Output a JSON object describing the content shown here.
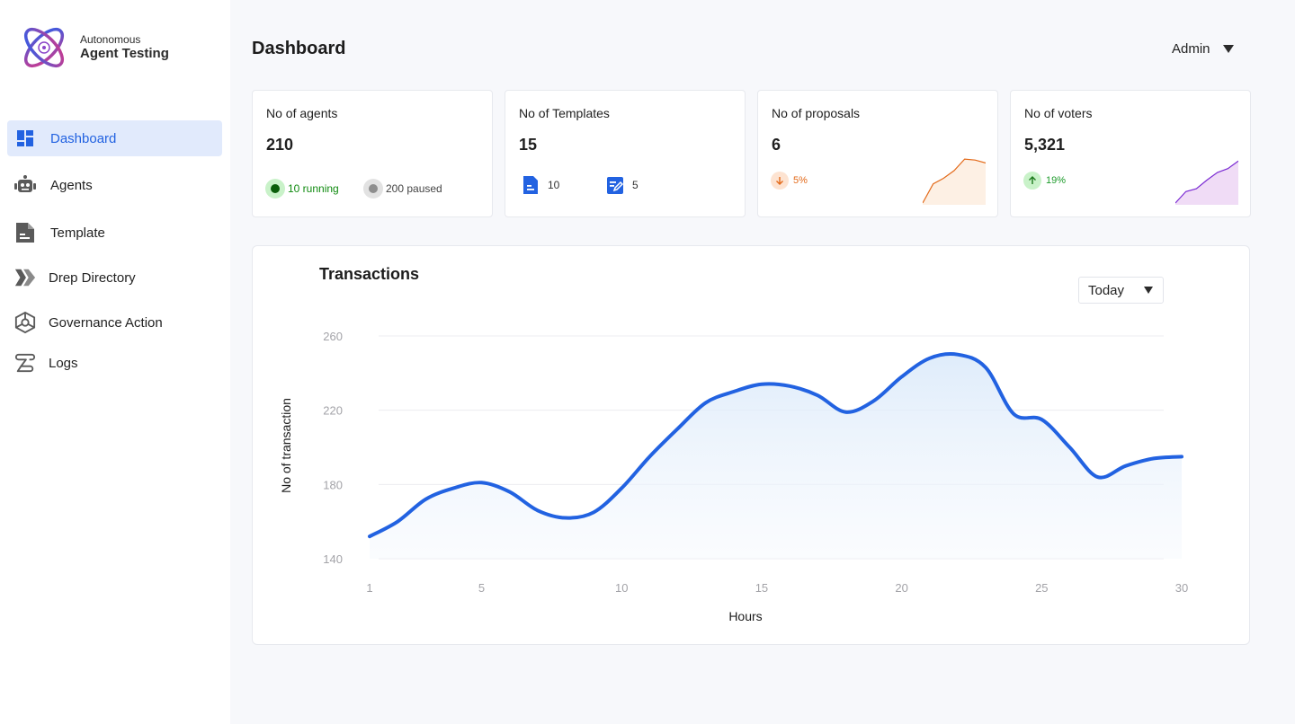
{
  "brand": {
    "line1": "Autonomous",
    "line2": "Agent Testing"
  },
  "sidebar": {
    "items": [
      {
        "label": "Dashboard",
        "icon": "dashboard-icon",
        "active": true
      },
      {
        "label": "Agents",
        "icon": "robot-icon"
      },
      {
        "label": "Template",
        "icon": "document-icon"
      },
      {
        "label": "Drep Directory",
        "icon": "chevrons-icon"
      },
      {
        "label": "Governance Action",
        "icon": "hexagon-network-icon"
      },
      {
        "label": "Logs",
        "icon": "scroll-icon"
      }
    ]
  },
  "header": {
    "title": "Dashboard",
    "user": "Admin"
  },
  "stats": {
    "agents": {
      "title": "No of agents",
      "value": "210",
      "running": "10 running",
      "paused": "200 paused"
    },
    "templates": {
      "title": "No of Templates",
      "value": "15",
      "docs": "10",
      "edited": "5"
    },
    "proposals": {
      "title": "No of proposals",
      "value": "6",
      "trend": "5%",
      "direction": "down"
    },
    "voters": {
      "title": "No of voters",
      "value": "5,321",
      "trend": "19%",
      "direction": "up"
    }
  },
  "colors": {
    "accent": "#2262e1",
    "active_bg": "#e1eafc",
    "running": "#0f8a0f",
    "paused": "#8e8e8e",
    "down": "#e36a1a",
    "up": "#1c9a2a",
    "voters_line": "#7b2bd3"
  },
  "chart": {
    "title": "Transactions",
    "period": "Today"
  },
  "chart_data": {
    "type": "area",
    "title": "Transactions",
    "xlabel": "Hours",
    "ylabel": "No of transaction",
    "x_ticks": [
      1,
      5,
      10,
      15,
      20,
      25,
      30
    ],
    "y_ticks": [
      140,
      180,
      220,
      260
    ],
    "ylim": [
      140,
      260
    ],
    "xlim": [
      1,
      30
    ],
    "grid": true,
    "series": [
      {
        "x": [
          1,
          2,
          3,
          4,
          5,
          6,
          7,
          8,
          9,
          10,
          11,
          12,
          13,
          14,
          15,
          16,
          17,
          18,
          19,
          20,
          21,
          22,
          23,
          24,
          25,
          26,
          27,
          28,
          29,
          30
        ],
        "values": [
          152,
          160,
          172,
          178,
          181,
          176,
          166,
          162,
          165,
          178,
          195,
          210,
          224,
          230,
          234,
          233,
          228,
          219,
          225,
          238,
          248,
          250,
          243,
          218,
          215,
          200,
          184,
          190,
          194,
          195
        ]
      }
    ]
  },
  "sparklines": {
    "proposals": [
      0,
      2,
      2.6,
      3.4,
      4.6,
      4.5,
      4.2
    ],
    "voters": [
      0,
      1.2,
      1.5,
      2.4,
      3.2,
      3.6,
      4.4
    ]
  }
}
